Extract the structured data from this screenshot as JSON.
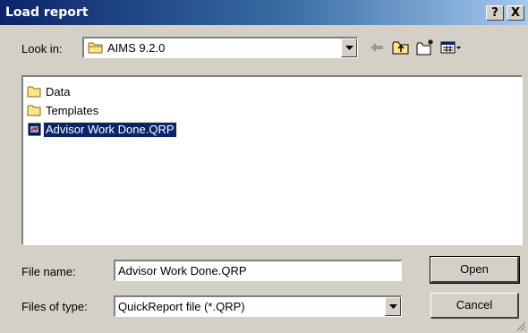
{
  "window": {
    "title": "Load report",
    "help_label": "?",
    "close_label": "X"
  },
  "lookin": {
    "label": "Look in:",
    "value": "AIMS 9.2.0"
  },
  "toolbar": {
    "icons": [
      "back-arrow-icon",
      "up-folder-icon",
      "new-folder-icon",
      "view-menu-icon"
    ]
  },
  "files": [
    {
      "name": "Data",
      "type": "folder",
      "selected": false
    },
    {
      "name": "Templates",
      "type": "folder",
      "selected": false
    },
    {
      "name": "Advisor Work Done.QRP",
      "type": "report",
      "selected": true
    }
  ],
  "filename": {
    "label": "File name:",
    "value": "Advisor Work Done.QRP"
  },
  "filetype": {
    "label": "Files of type:",
    "value": "QuickReport file (*.QRP)"
  },
  "buttons": {
    "open": "Open",
    "cancel": "Cancel"
  },
  "colors": {
    "titlebar_start": "#0a246a",
    "titlebar_end": "#a6caf0",
    "face": "#d4d0c8",
    "selection": "#0a246a"
  }
}
